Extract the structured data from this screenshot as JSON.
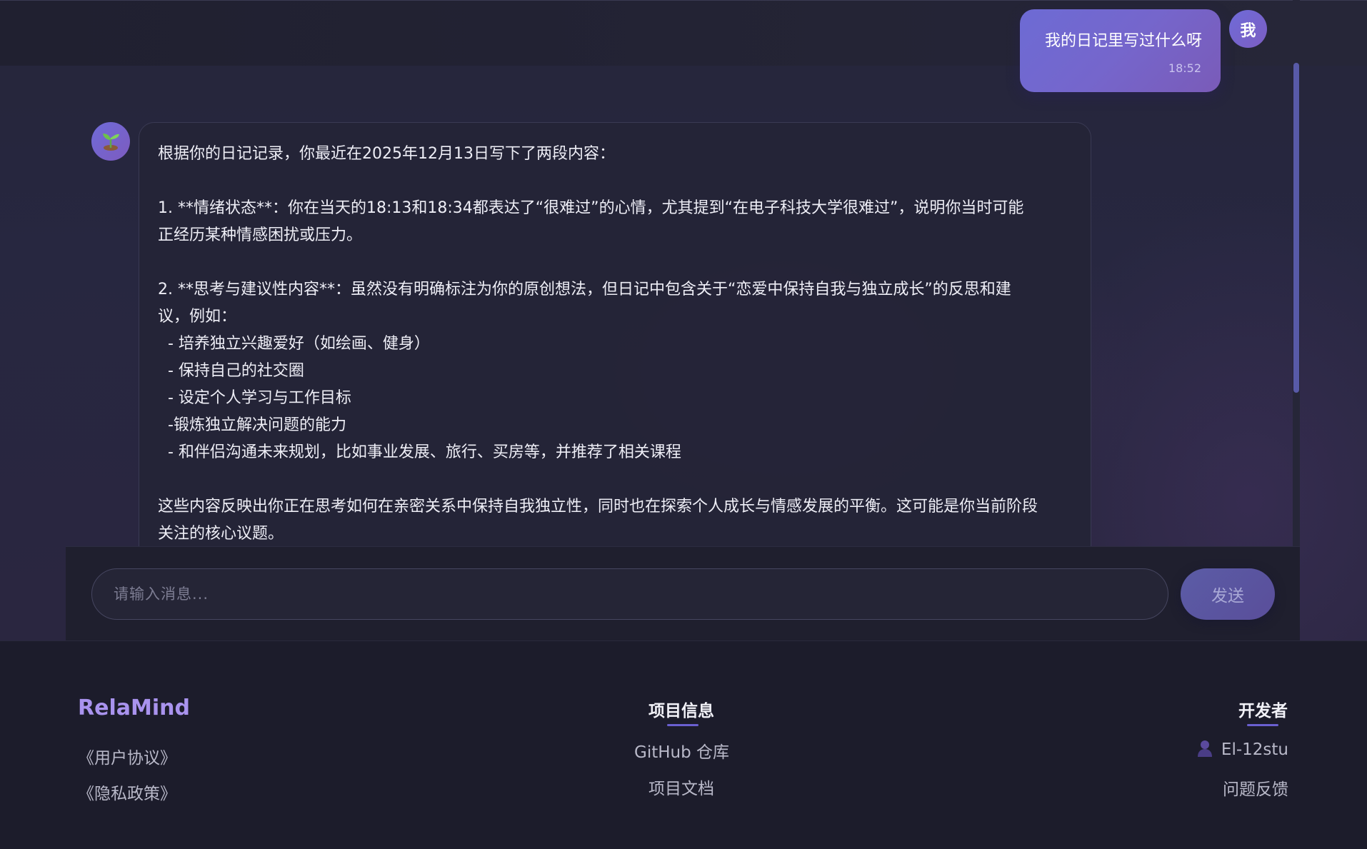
{
  "chat": {
    "user_message": {
      "avatar_label": "我",
      "text": "我的日记里写过什么呀",
      "time": "18:52"
    },
    "bot_message": {
      "avatar_icon": "sprout-icon",
      "lines": [
        "根据你的日记记录，你最近在2025年12月13日写下了两段内容：",
        "",
        "1. **情绪状态**：你在当天的18:13和18:34都表达了“很难过”的心情，尤其提到“在电子科技大学很难过”，说明你当时可能",
        "正经历某种情感困扰或压力。",
        "",
        "2. **思考与建议性内容**：虽然没有明确标注为你的原创想法，但日记中包含关于“恋爱中保持自我与独立成长”的反思和建",
        "议，例如：",
        "  - 培养独立兴趣爱好（如绘画、健身）",
        "  - 保持自己的社交圈",
        "  - 设定个人学习与工作目标",
        "  -锻炼独立解决问题的能力",
        "  - 和伴侣沟通未来规划，比如事业发展、旅行、买房等，并推荐了相关课程",
        "",
        "这些内容反映出你正在思考如何在亲密关系中保持自我独立性，同时也在探索个人成长与情感发展的平衡。这可能是你当前阶段",
        "关注的核心议题。"
      ]
    }
  },
  "input": {
    "placeholder": "请输入消息...",
    "value": "",
    "send_label": "发送"
  },
  "footer": {
    "brand": "RelaMind",
    "legal_links": [
      "《用户协议》",
      "《隐私政策》"
    ],
    "project": {
      "title": "项目信息",
      "links": [
        "GitHub 仓库",
        "项目文档"
      ]
    },
    "developer": {
      "title": "开发者",
      "name": "El-12stu",
      "feedback": "问题反馈"
    }
  },
  "colors": {
    "accent": "#6d6bd4",
    "brand": "#a993ee",
    "background": "#1c1c2b"
  }
}
